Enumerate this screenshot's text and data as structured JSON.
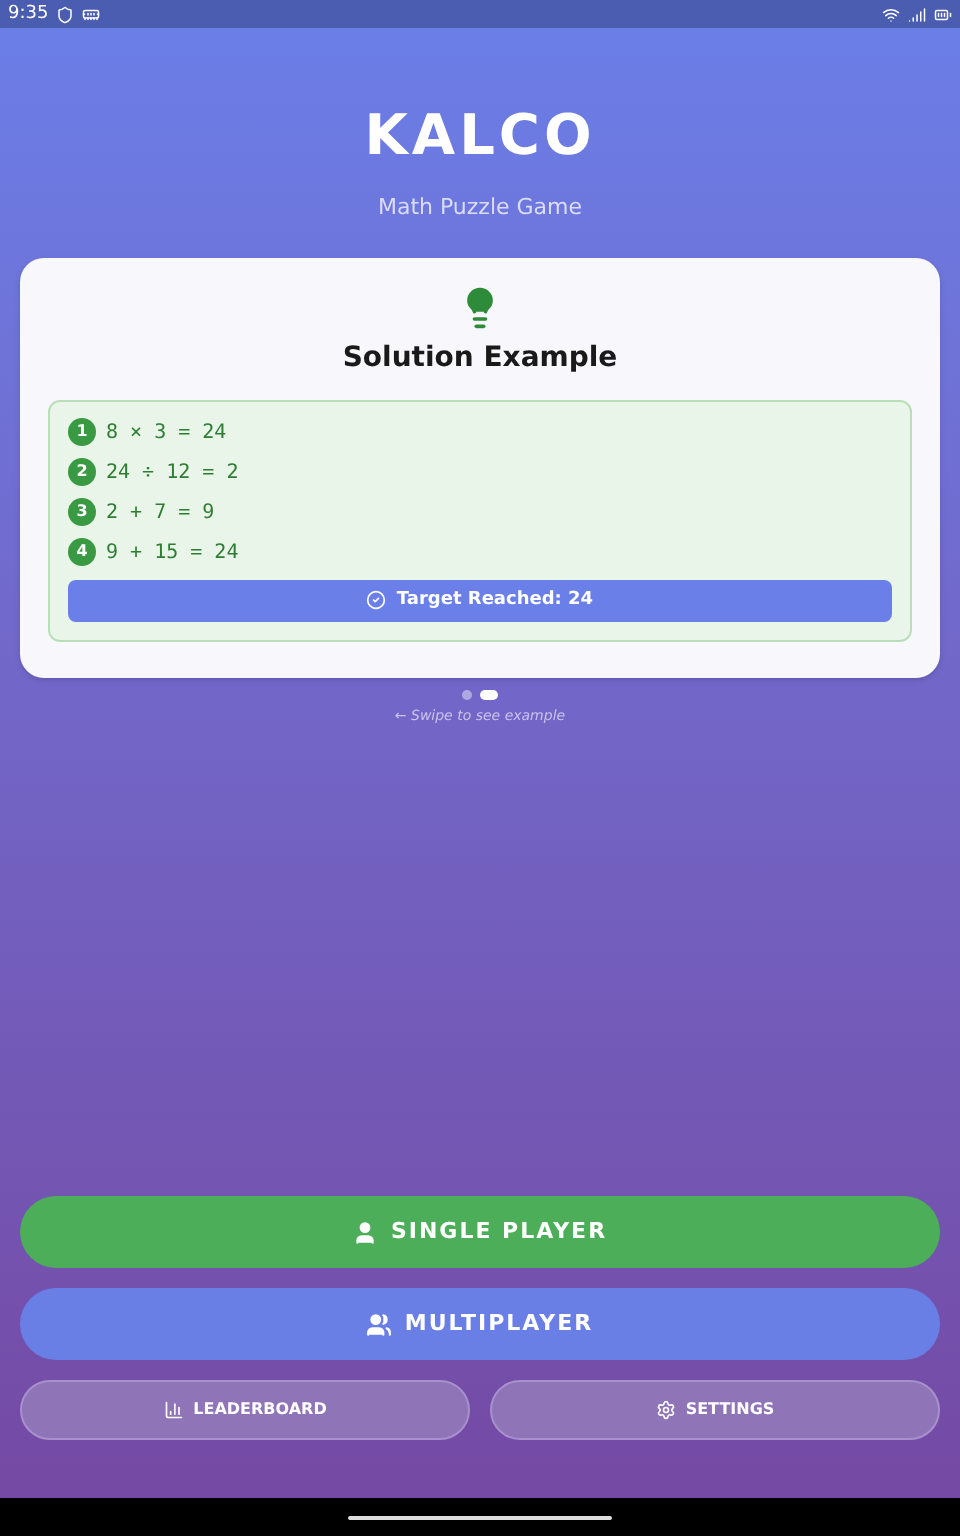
{
  "status_bar": {
    "time": "9:35"
  },
  "header": {
    "title": "KALCO",
    "subtitle": "Math Puzzle Game"
  },
  "example_card": {
    "title": "Solution Example",
    "steps": [
      {
        "number": "1",
        "equation": "8 × 3 = 24"
      },
      {
        "number": "2",
        "equation": "24 ÷ 12 = 2"
      },
      {
        "number": "3",
        "equation": "2 + 7 = 9"
      },
      {
        "number": "4",
        "equation": "9 + 15 = 24"
      }
    ],
    "result": "Target Reached: 24"
  },
  "pages": [
    {
      "selected": false
    },
    {
      "selected": true
    }
  ],
  "hint": "← Swipe to see example",
  "buttons": [
    {
      "kind": "primary",
      "label": "SINGLE PLAYER"
    },
    {
      "kind": "secondary",
      "label": "MULTIPLAYER"
    }
  ],
  "small_buttons": [
    {
      "label": "LEADERBOARD"
    },
    {
      "label": "SETTINGS"
    }
  ]
}
